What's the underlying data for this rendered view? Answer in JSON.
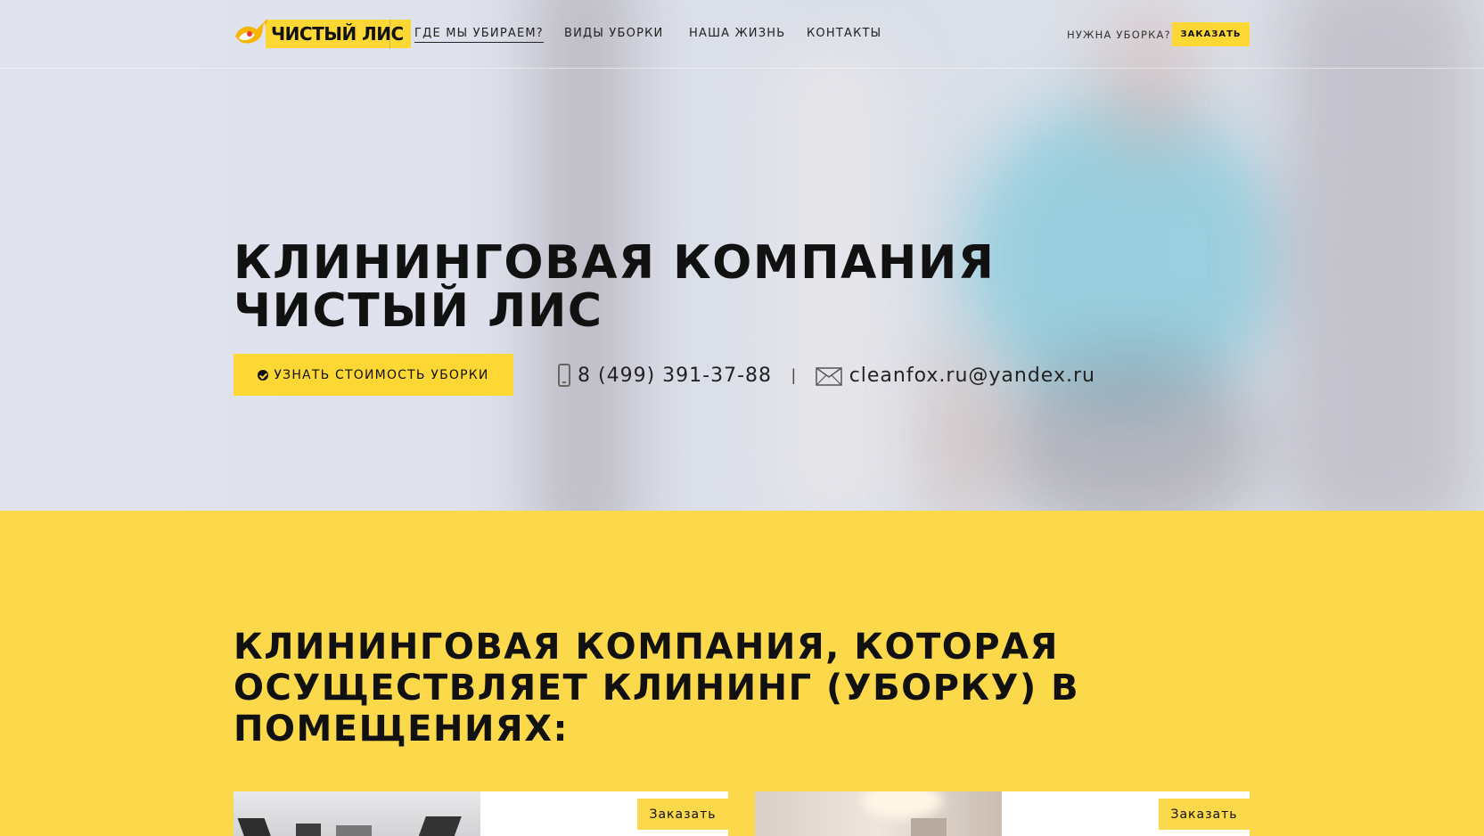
{
  "brand": {
    "logo_text": "ЧИСТЫЙ ЛИС",
    "logo_icon": "fox-icon",
    "accent_color": "#fdd835"
  },
  "nav": {
    "items": [
      {
        "label": "ГДЕ МЫ УБИРАЕМ?",
        "active": true
      },
      {
        "label": "ВИДЫ УБОРКИ",
        "active": false
      },
      {
        "label": "НАША ЖИЗНЬ",
        "active": false
      },
      {
        "label": "КОНТАКТЫ",
        "active": false
      }
    ],
    "need_label": "НУЖНА УБОРКА?",
    "order_label": "ЗАКАЗАТЬ"
  },
  "hero": {
    "title": "КЛИНИНГОВАЯ КОМПАНИЯ ЧИСТЫЙ ЛИС",
    "cta_label": "УЗНАТЬ СТОИМОСТЬ УБОРКИ",
    "cta_icon": "check-circle-icon",
    "phone": "8 (499) 391-37-88",
    "phone_icon": "mobile-phone-icon",
    "separator": "|",
    "email": "cleanfox.ru@yandex.ru",
    "email_icon": "envelope-icon"
  },
  "section": {
    "title": "КЛИНИНГОВАЯ КОМПАНИЯ, КОТОРАЯ ОСУЩЕСТВЛЯЕТ КЛИНИНГ (УБОРКУ) В ПОМЕЩЕНИЯХ:",
    "background_color": "#fcd94a",
    "cards": [
      {
        "order_label": "Заказать"
      },
      {
        "order_label": "Заказать"
      }
    ]
  }
}
